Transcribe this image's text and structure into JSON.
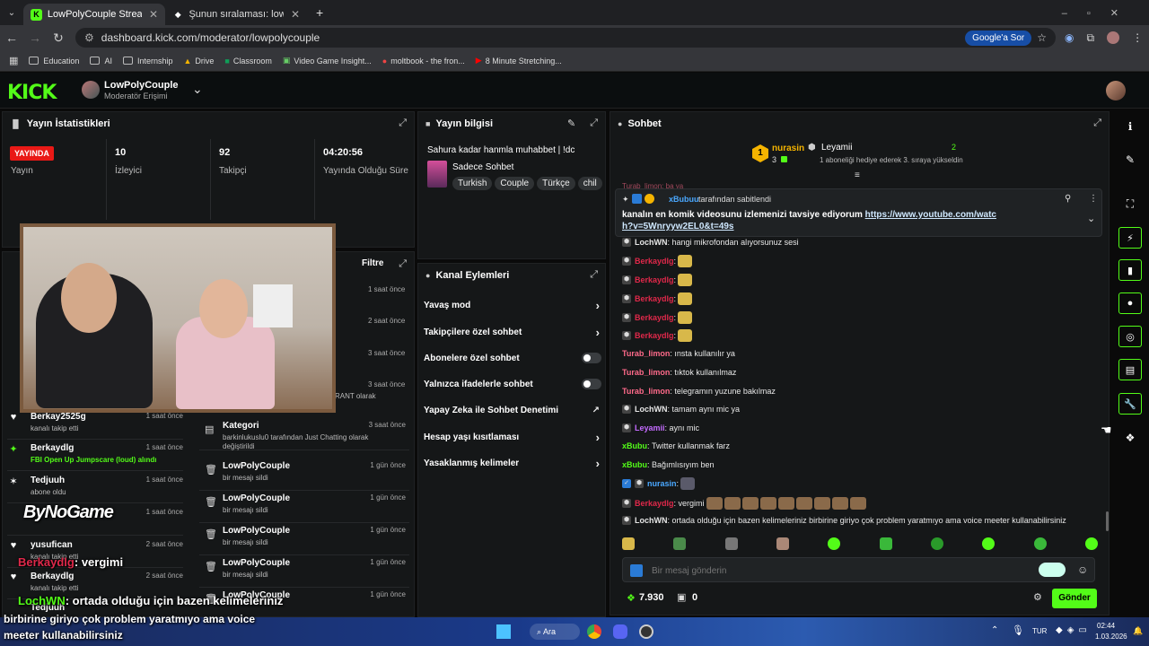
{
  "browser": {
    "tabs": [
      {
        "label": "LowPolyCouple Stream - Kick D",
        "active": true
      },
      {
        "label": "Şunun sıralaması: lowpolycoupl",
        "active": false
      }
    ],
    "new_tab": "+",
    "url": "dashboard.kick.com/moderator/lowpolycouple",
    "google_search": "Google'a Sor",
    "bookmarks": [
      "Education",
      "AI",
      "Internship",
      "Drive",
      "Classroom",
      "Video Game Insight...",
      "moltbook - the fron...",
      "8 Minute Stretching..."
    ]
  },
  "header": {
    "logo": "KICK",
    "channel_name": "LowPolyCouple",
    "channel_role": "Moderatör Erişimi"
  },
  "stats_panel": {
    "title": "Yayın İstatistikleri",
    "live_badge": "YAYINDA",
    "items": [
      {
        "value": "",
        "label": "Yayın"
      },
      {
        "value": "10",
        "label": "İzleyici"
      },
      {
        "value": "92",
        "label": "Takipçi"
      },
      {
        "value": "04:20:56",
        "label": "Yayında Olduğu Süre"
      }
    ]
  },
  "activity": {
    "filter": "Filtre",
    "top_times": [
      "1 saat önce",
      "2 saat önce",
      "3 saat önce",
      "3 saat önce"
    ],
    "partial_text": "RANT olarak",
    "items": [
      {
        "name": "Berkay2525g",
        "sub": "kanalı takip etti",
        "time": "1 saat önce",
        "icon": "♥"
      },
      {
        "name": "Berkaydlg",
        "sub": "FBI Open Up Jumpscare (loud) alındı",
        "time": "1 saat önce",
        "icon": "✦"
      },
      {
        "name": "Tedjuuh",
        "sub": "abone oldu",
        "time": "1 saat önce",
        "icon": "✶"
      },
      {
        "name": "",
        "sub": "",
        "time": "1 saat önce",
        "icon": ""
      },
      {
        "name": "yusufican",
        "sub": "kanalı takip etti",
        "time": "2 saat önce",
        "icon": "♥"
      },
      {
        "name": "Berkaydlg",
        "sub": "kanalı takip etti",
        "time": "2 saat önce",
        "icon": "♥"
      },
      {
        "name": "Tedjuuh",
        "sub": "",
        "time": "",
        "icon": ""
      }
    ]
  },
  "modlog": {
    "items": [
      {
        "name": "Kategori",
        "sub": "barkinlukuslu0 tarafından Just Chatting olarak değiştirildi",
        "time": "3 saat önce"
      },
      {
        "name": "LowPolyCouple",
        "sub": "bir mesajı sildi",
        "time": "1 gün önce"
      },
      {
        "name": "LowPolyCouple",
        "sub": "bir mesajı sildi",
        "time": "1 gün önce"
      },
      {
        "name": "LowPolyCouple",
        "sub": "bir mesajı sildi",
        "time": "1 gün önce"
      },
      {
        "name": "LowPolyCouple",
        "sub": "bir mesajı sildi",
        "time": "1 gün önce"
      },
      {
        "name": "LowPolyCouple",
        "sub": "",
        "time": "1 gün önce"
      }
    ]
  },
  "stream_info": {
    "title": "Yayın bilgisi",
    "stream_title": "Sahura kadar hanmla muhabbet | !dc",
    "category": "Sadece Sohbet",
    "tags": [
      "Turkish",
      "Couple",
      "Türkçe",
      "chil"
    ]
  },
  "channel_actions": {
    "title": "Kanal Eylemleri",
    "items": [
      {
        "label": "Yavaş mod",
        "kind": "arrow"
      },
      {
        "label": "Takipçilere özel sohbet",
        "kind": "arrow"
      },
      {
        "label": "Abonelere özel sohbet",
        "kind": "toggle"
      },
      {
        "label": "Yalnızca ifadelerle sohbet",
        "kind": "toggle"
      },
      {
        "label": "Yapay Zeka ile Sohbet Denetimi",
        "kind": "external"
      },
      {
        "label": "Hesap yaşı kısıtlaması",
        "kind": "arrow"
      },
      {
        "label": "Yasaklanmış kelimeler",
        "kind": "arrow"
      }
    ]
  },
  "chat": {
    "title": "Sohbet",
    "leader_first": "nurasin",
    "leader_first_count": "3",
    "leader_first_rank": "1",
    "leader_second": "Leyamii",
    "leader_second_count": "2",
    "leader_note": "1 aboneliği hediye ederek 3. sıraya yükseldin",
    "pinned_by": "xBubuu",
    "pinned_by_suffix": "tarafından sabitlendi",
    "pinned_text": "kanalın en komik videosunu izlemenizi tavsiye ediyorum",
    "pinned_link": "https://www.youtube.com/watch?v=5Wnryyw2EL0&t=49s",
    "partial_top": "Turab_limon: ba ya",
    "messages": [
      {
        "user": "LochWN",
        "color": "#e6e6e6",
        "text": "hangi mikrofondan alıyorsunuz sesi"
      },
      {
        "user": "Berkaydlg",
        "color": "#e0284a",
        "text": ""
      },
      {
        "user": "Berkaydlg",
        "color": "#e0284a",
        "text": ""
      },
      {
        "user": "Berkaydlg",
        "color": "#e0284a",
        "text": ""
      },
      {
        "user": "Berkaydlg",
        "color": "#e0284a",
        "text": ""
      },
      {
        "user": "Berkaydlg",
        "color": "#e0284a",
        "text": ""
      },
      {
        "user": "Turab_limon",
        "color": "#ff6a8a",
        "text": "ınsta kullanılır ya"
      },
      {
        "user": "Turab_limon",
        "color": "#ff6a8a",
        "text": "tıktok kullanılmaz"
      },
      {
        "user": "Turab_limon",
        "color": "#ff6a8a",
        "text": "telegramın yuzune bakılmaz"
      },
      {
        "user": "LochWN",
        "color": "#e6e6e6",
        "text": "tamam aynı mic ya"
      },
      {
        "user": "Leyamii",
        "color": "#c46bff",
        "text": "aynı mic"
      },
      {
        "user": "xBubu",
        "color": "#53fc18",
        "text": "Twitter kullanmak farz"
      },
      {
        "user": "xBubu",
        "color": "#53fc18",
        "text": "Bağımlısıyım ben"
      },
      {
        "user": "nurasin",
        "color": "#4aa8ff",
        "text": ""
      },
      {
        "user": "Berkaydlg",
        "color": "#e0284a",
        "text": "vergimi"
      },
      {
        "user": "LochWN",
        "color": "#e6e6e6",
        "text": "ortada olduğu için bazen kelimeleriniz birbirine giriyo çok problem yaratmıyo ama voice meeter kullanabilirsiniz"
      }
    ],
    "input_placeholder": "Bir mesaj gönderin",
    "points": "7.930",
    "gifts": "0",
    "send": "Gönder"
  },
  "overlay": {
    "brand": "ByNoGame",
    "line1_user": "Berkaydlg",
    "line1_text": ": vergimi",
    "line2_user": "LochWN",
    "line2_text": ": ortada olduğu için bazen kelimeleriniz",
    "line3": "birbirine giriyo çok problem yaratmıyo ama voice",
    "line4": "meeter kullanabilirsiniz"
  },
  "taskbar": {
    "search": "Ara",
    "lang": "TUR",
    "time": "02:44",
    "date": "1.03.2026"
  },
  "colors": {
    "accent": "#53fc18",
    "live": "#e91916",
    "bg": "#0b0e0f",
    "panel": "#151718"
  }
}
